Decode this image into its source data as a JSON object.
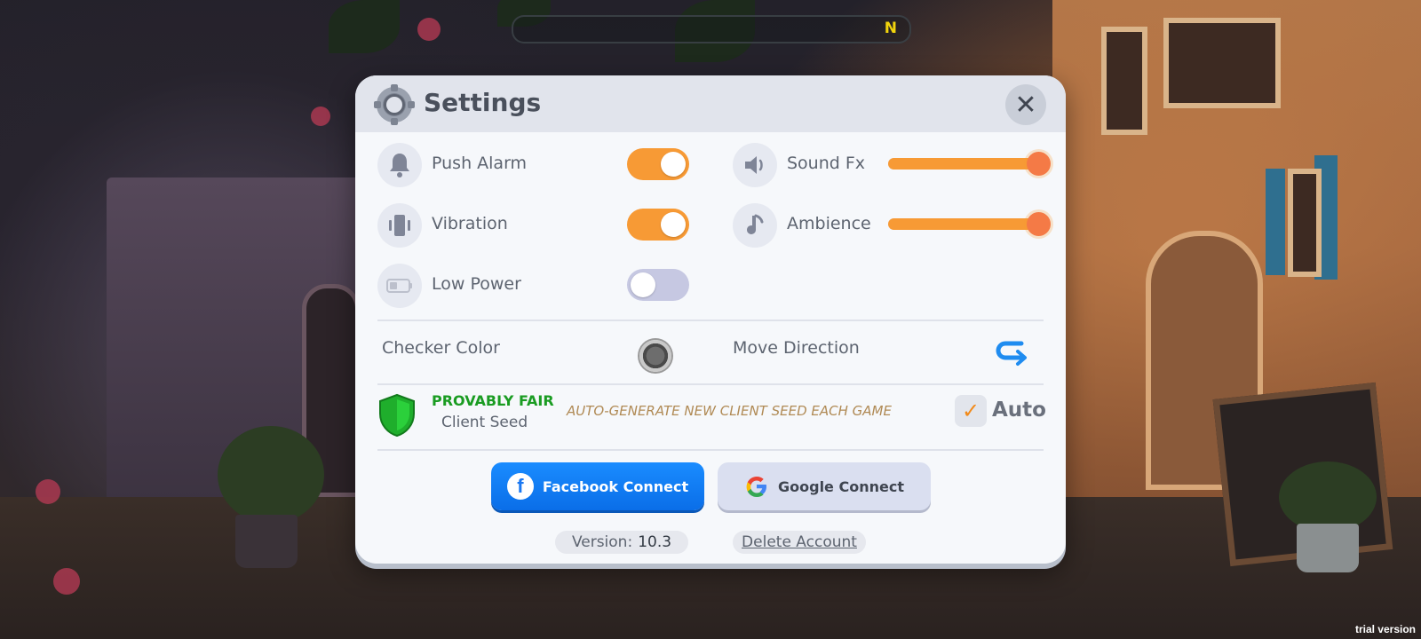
{
  "top_bar": {
    "letter": "N"
  },
  "watermark": "trial version",
  "settings": {
    "title": "Settings",
    "toggles": [
      {
        "label": "Push Alarm",
        "on": true,
        "icon": "bell-icon"
      },
      {
        "label": "Vibration",
        "on": true,
        "icon": "phone-vibrate-icon"
      },
      {
        "label": "Low Power",
        "on": false,
        "icon": "battery-icon"
      }
    ],
    "sliders": [
      {
        "label": "Sound Fx",
        "value": 1.0,
        "icon": "speaker-icon"
      },
      {
        "label": "Ambience",
        "value": 1.0,
        "icon": "music-note-icon"
      }
    ],
    "checker_color_label": "Checker Color",
    "move_direction_label": "Move Direction",
    "provably_fair": {
      "title": "PROVABLY FAIR",
      "subtitle": "Client Seed",
      "description": "AUTO-GENERATE NEW CLIENT SEED EACH GAME",
      "auto_label": "Auto",
      "auto_checked": true
    },
    "facebook_button": "Facebook Connect",
    "google_button": "Google Connect",
    "version_label": "Version:",
    "version_value": "10.3",
    "delete_account": "Delete Account"
  },
  "colors": {
    "accent_orange": "#f79a35",
    "facebook_blue": "#1a8cff",
    "provably_green": "#1a9c22"
  }
}
